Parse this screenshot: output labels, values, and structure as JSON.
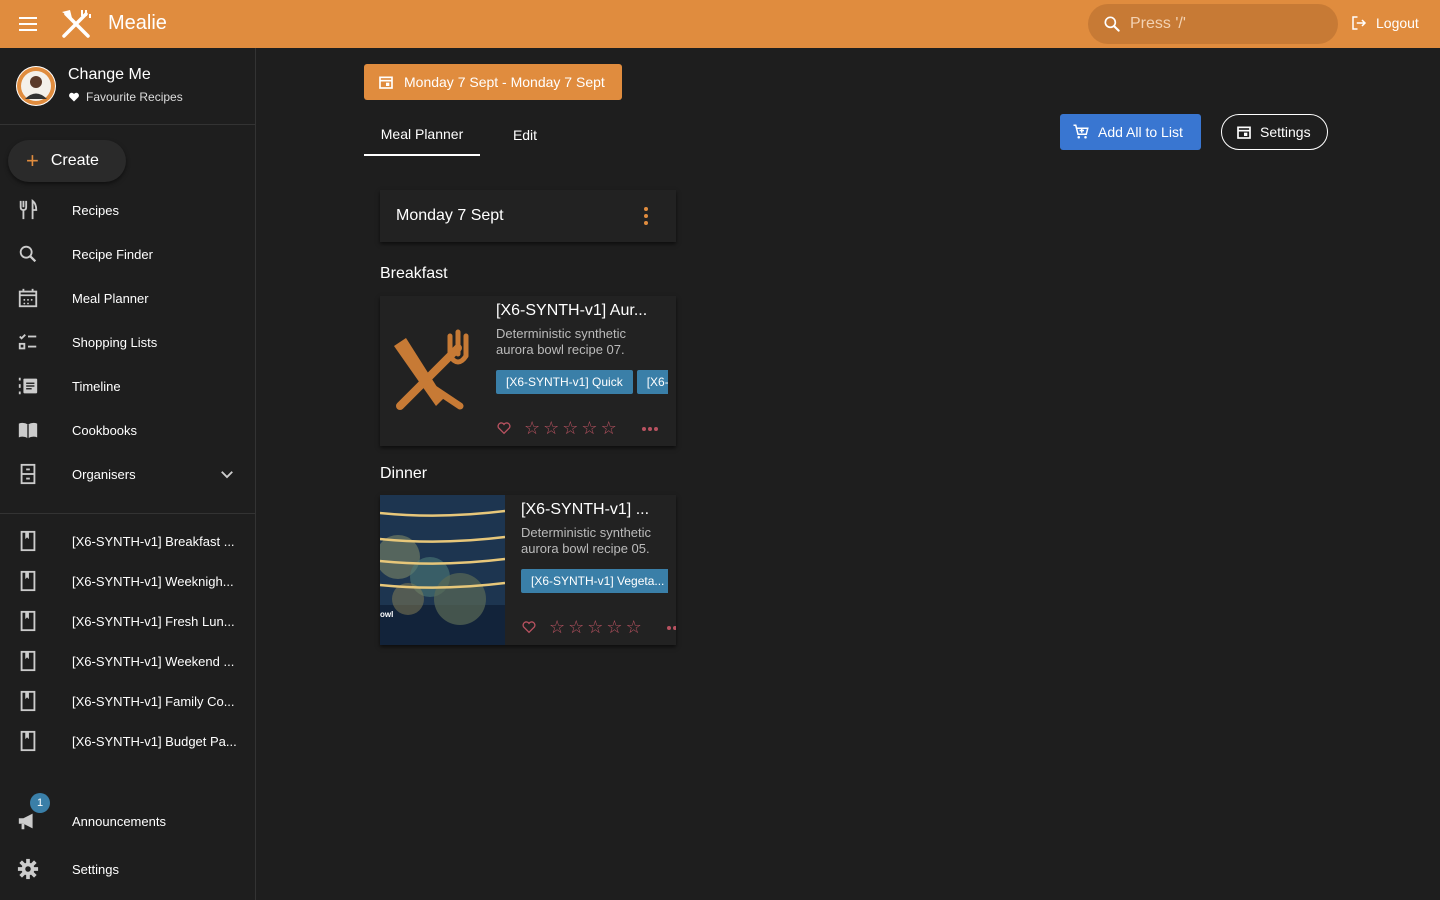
{
  "app": {
    "title": "Mealie"
  },
  "search": {
    "placeholder": "Press '/'"
  },
  "logout": {
    "label": "Logout"
  },
  "user": {
    "name": "Change Me",
    "favourites_label": "Favourite Recipes"
  },
  "create": {
    "label": "Create"
  },
  "nav": {
    "items": [
      {
        "label": "Recipes",
        "icon": "fork-knife-icon"
      },
      {
        "label": "Recipe Finder",
        "icon": "search-icon"
      },
      {
        "label": "Meal Planner",
        "icon": "calendar-icon"
      },
      {
        "label": "Shopping Lists",
        "icon": "checklist-icon"
      },
      {
        "label": "Timeline",
        "icon": "timeline-icon"
      },
      {
        "label": "Cookbooks",
        "icon": "book-open-icon"
      },
      {
        "label": "Organisers",
        "icon": "file-cabinet-icon"
      }
    ]
  },
  "cookbooks": [
    {
      "label": "[X6-SYNTH-v1] Breakfast ..."
    },
    {
      "label": "[X6-SYNTH-v1] Weeknigh..."
    },
    {
      "label": "[X6-SYNTH-v1] Fresh Lun..."
    },
    {
      "label": "[X6-SYNTH-v1] Weekend ..."
    },
    {
      "label": "[X6-SYNTH-v1] Family Co..."
    },
    {
      "label": "[X6-SYNTH-v1] Budget Pa..."
    }
  ],
  "bottom_nav": {
    "announcements": {
      "label": "Announcements",
      "badge": "1"
    },
    "settings": {
      "label": "Settings"
    }
  },
  "planner": {
    "date_range": "Monday 7 Sept - Monday 7 Sept",
    "tabs": [
      {
        "label": "Meal Planner",
        "active": true
      },
      {
        "label": "Edit",
        "active": false
      }
    ],
    "add_all_label": "Add All to List",
    "settings_label": "Settings",
    "day": {
      "title": "Monday 7 Sept",
      "meals": [
        {
          "type": "Breakfast",
          "recipe": {
            "title": "[X6-SYNTH-v1] Aur...",
            "description_line1": "Deterministic synthetic",
            "description_line2": "aurora bowl recipe 07.",
            "tags": [
              "[X6-SYNTH-v1] Quick",
              "[X6-"
            ],
            "rating": 0
          }
        },
        {
          "type": "Dinner",
          "recipe": {
            "title": "[X6-SYNTH-v1] ...",
            "description_line1": "Deterministic synthetic",
            "description_line2": "aurora bowl recipe 05.",
            "tags": [
              "[X6-SYNTH-v1] Vegeta..."
            ],
            "rating": 0,
            "image_caption": "owl"
          }
        }
      ]
    }
  },
  "colors": {
    "primary": "#e08c3e",
    "background": "#1e1e1e",
    "card": "#222222",
    "tag": "#3a7fa8",
    "button_blue": "#3976d1",
    "rating": "#b85260"
  }
}
